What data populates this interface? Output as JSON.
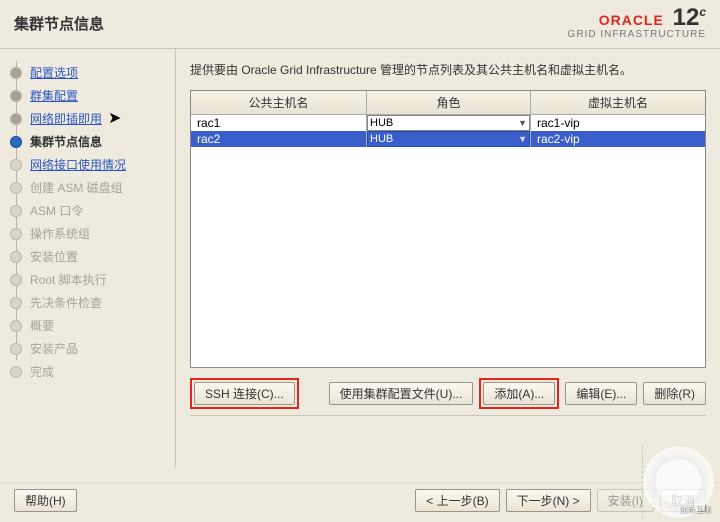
{
  "header": {
    "title": "集群节点信息",
    "brand": "ORACLE",
    "sub": "GRID INFRASTRUCTURE",
    "version": "12",
    "version_sup": "c"
  },
  "sidebar": {
    "steps": [
      {
        "label": "配置选项",
        "state": "done",
        "link": true
      },
      {
        "label": "群集配置",
        "state": "done",
        "link": true
      },
      {
        "label": "网络即插即用",
        "state": "done",
        "link": true
      },
      {
        "label": "集群节点信息",
        "state": "current",
        "link": false
      },
      {
        "label": "网络接口使用情况",
        "state": "future",
        "link": true
      },
      {
        "label": "创建 ASM 磁盘组",
        "state": "disabled",
        "link": false
      },
      {
        "label": "ASM 口令",
        "state": "disabled",
        "link": false
      },
      {
        "label": "操作系统组",
        "state": "disabled",
        "link": false
      },
      {
        "label": "安装位置",
        "state": "disabled",
        "link": false
      },
      {
        "label": "Root 脚本执行",
        "state": "disabled",
        "link": false
      },
      {
        "label": "先决条件检查",
        "state": "disabled",
        "link": false
      },
      {
        "label": "概要",
        "state": "disabled",
        "link": false
      },
      {
        "label": "安装产品",
        "state": "disabled",
        "link": false
      },
      {
        "label": "完成",
        "state": "disabled",
        "link": false
      }
    ]
  },
  "content": {
    "desc": "提供要由 Oracle Grid Infrastructure 管理的节点列表及其公共主机名和虚拟主机名。",
    "columns": {
      "public": "公共主机名",
      "role": "角色",
      "vip": "虚拟主机名"
    },
    "rows": [
      {
        "public": "rac1",
        "role": "HUB",
        "vip": "rac1-vip",
        "selected": false
      },
      {
        "public": "rac2",
        "role": "HUB",
        "vip": "rac2-vip",
        "selected": true
      }
    ],
    "buttons": {
      "ssh": "SSH 连接(C)...",
      "usefile": "使用集群配置文件(U)...",
      "add": "添加(A)...",
      "edit": "编辑(E)...",
      "delete": "删除(R)"
    }
  },
  "footer": {
    "help": "帮助(H)",
    "back": "< 上一步(B)",
    "next": "下一步(N) >",
    "install": "安装(I)",
    "cancel": "取消"
  },
  "watermark": "创新互联"
}
